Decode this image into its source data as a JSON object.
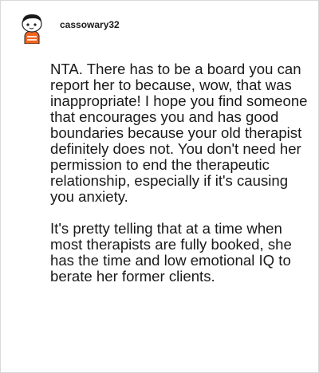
{
  "comment": {
    "username": "cassowary32",
    "paragraphs": [
      "NTA. There has to be a board you can report her to because, wow, that was inappropriate! I hope you find someone that encourages you and has good boundaries because your old therapist definitely does not. You don't need her permission to end the therapeutic relationship, especially if it's causing you anxiety.",
      "It's pretty telling that at a time when most therapists are fully booked, she has the time and low emotional IQ to berate her former clients."
    ]
  },
  "avatar": {
    "icon": "snoo-avatar-icon",
    "colors": {
      "face": "#ffffff",
      "hair": "#1a1a1a",
      "shirt": "#f2641e",
      "skin_outline": "#222222"
    }
  }
}
